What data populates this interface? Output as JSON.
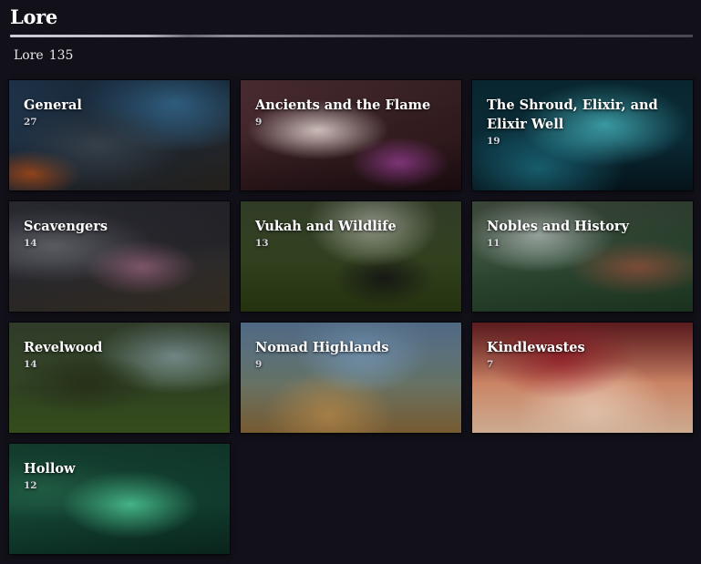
{
  "header": {
    "title": "Lore",
    "count_label": "Lore",
    "count_value": "135"
  },
  "categories": [
    {
      "name": "General",
      "count": "27"
    },
    {
      "name": "Ancients and the Flame",
      "count": "9"
    },
    {
      "name": "The Shroud, Elixir, and Elixir Well",
      "count": "19"
    },
    {
      "name": "Scavengers",
      "count": "14"
    },
    {
      "name": "Vukah and Wildlife",
      "count": "13"
    },
    {
      "name": "Nobles and History",
      "count": "11"
    },
    {
      "name": "Revelwood",
      "count": "14"
    },
    {
      "name": "Nomad Highlands",
      "count": "9"
    },
    {
      "name": "Kindlewastes",
      "count": "7"
    },
    {
      "name": "Hollow",
      "count": "12"
    }
  ],
  "colors": {
    "background": "#12111a",
    "text": "#ffffff",
    "subtext": "#d6d4dc"
  }
}
